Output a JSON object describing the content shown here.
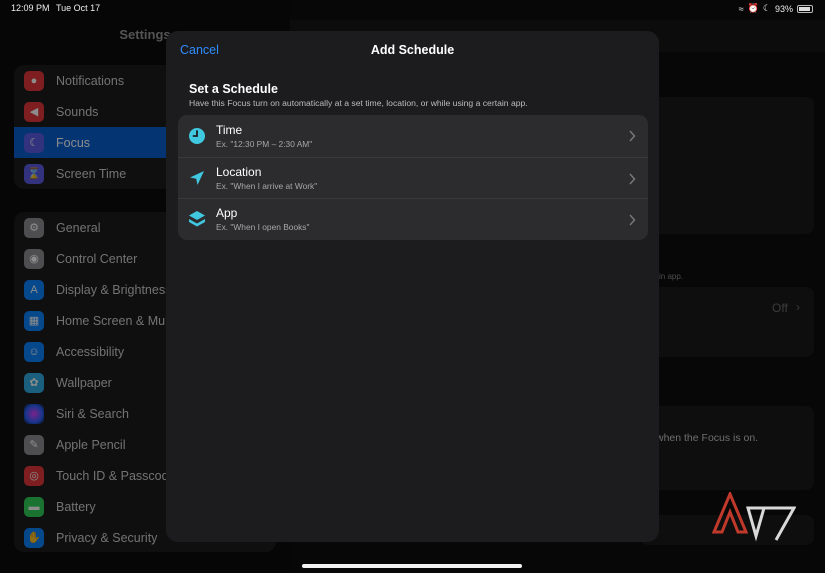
{
  "status": {
    "time": "12:09 PM",
    "date": "Tue Oct 17",
    "battery": "93%"
  },
  "sidebar": {
    "title": "Settings",
    "group1": [
      {
        "label": "Notifications",
        "color": "#e5383b"
      },
      {
        "label": "Sounds",
        "color": "#e5383b"
      },
      {
        "label": "Focus",
        "color": "#5e5ce6",
        "active": true
      },
      {
        "label": "Screen Time",
        "color": "#5e5ce6"
      }
    ],
    "group2": [
      {
        "label": "General",
        "color": "#8e8e93"
      },
      {
        "label": "Control Center",
        "color": "#8e8e93"
      },
      {
        "label": "Display & Brightness",
        "color": "#0a84ff"
      },
      {
        "label": "Home Screen & Mult",
        "color": "#0a84ff"
      },
      {
        "label": "Accessibility",
        "color": "#0a84ff"
      },
      {
        "label": "Wallpaper",
        "color": "#32ade6"
      },
      {
        "label": "Siri & Search",
        "color": "#333"
      },
      {
        "label": "Apple Pencil",
        "color": "#8e8e93"
      },
      {
        "label": "Touch ID & Passcode",
        "color": "#e5383b"
      },
      {
        "label": "Battery",
        "color": "#30d158"
      },
      {
        "label": "Privacy & Security",
        "color": "#0a84ff"
      }
    ]
  },
  "background_pane": {
    "off_label": "Off",
    "hint_text": "in app.",
    "focus_note": "when the Focus is on."
  },
  "modal": {
    "cancel_label": "Cancel",
    "title": "Add Schedule",
    "heading": "Set a Schedule",
    "subtitle": "Have this Focus turn on automatically at a set time, location, or while using a certain app.",
    "options": [
      {
        "title": "Time",
        "example": "Ex. \"12:30 PM – 2:30 AM\"",
        "icon": "clock-icon"
      },
      {
        "title": "Location",
        "example": "Ex. \"When I arrive at Work\"",
        "icon": "location-arrow-icon"
      },
      {
        "title": "App",
        "example": "Ex. \"When I open Books\"",
        "icon": "app-stack-icon"
      }
    ]
  },
  "colors": {
    "accent": "#2f8cff",
    "icon_tint": "#40c8e0"
  }
}
